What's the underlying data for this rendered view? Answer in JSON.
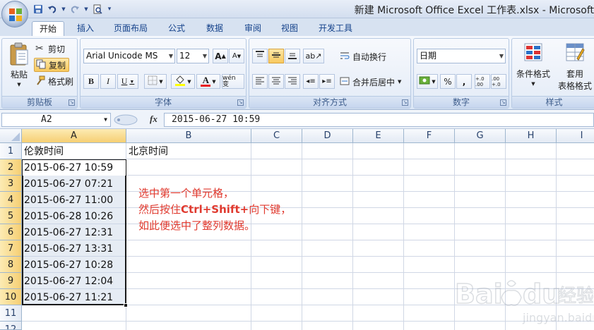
{
  "window": {
    "title": "新建 Microsoft Office Excel 工作表.xlsx - Microsoft"
  },
  "tabs": [
    "开始",
    "插入",
    "页面布局",
    "公式",
    "数据",
    "审阅",
    "视图",
    "开发工具"
  ],
  "ribbon": {
    "clipboard": {
      "label": "剪贴板",
      "paste": "粘贴",
      "cut": "剪切",
      "copy": "复制",
      "format_painter": "格式刷"
    },
    "font": {
      "label": "字体",
      "font_name": "Arial Unicode MS",
      "font_size": "12",
      "bold": "B",
      "italic": "I",
      "underline": "U",
      "grow": "A",
      "shrink": "A",
      "pinyin": "wén 变"
    },
    "alignment": {
      "label": "对齐方式",
      "wrap_text": "自动换行",
      "merge_center": "合并后居中"
    },
    "number": {
      "label": "数字",
      "format": "日期",
      "percent": "%",
      "comma": ",",
      "inc_decimal": "+.0 .00",
      "dec_decimal": ".00 +.0"
    },
    "styles": {
      "label": "样式",
      "conditional": "条件格式",
      "format_table": "套用",
      "format_table_2": "表格格式"
    }
  },
  "formula_bar": {
    "name_box": "A2",
    "fx": "fx",
    "value": "2015-06-27 10:59"
  },
  "sheet": {
    "columns": [
      "A",
      "B",
      "C",
      "D",
      "E",
      "F",
      "G",
      "H",
      "I"
    ],
    "rows": [
      "1",
      "2",
      "3",
      "4",
      "5",
      "6",
      "7",
      "8",
      "9",
      "10",
      "11",
      "12"
    ],
    "header_a1": "伦敦时间",
    "header_b1": "北京时间",
    "column_a_values": [
      "2015-06-27 10:59",
      "2015-06-27 07:21",
      "2015-06-27 11:00",
      "2015-06-28 10:26",
      "2015-06-27 12:31",
      "2015-06-27 13:31",
      "2015-06-27 10:28",
      "2015-06-27 12:04",
      "2015-06-27 11:21"
    ]
  },
  "annotation": {
    "line1": "选中第一个单元格，",
    "line2_pre": "然后按住",
    "line2_kbd": "Ctrl+Shift+",
    "line2_post": "向下键，",
    "line3": "如此便选中了整列数据。"
  },
  "colors": {
    "ribbon_bg": "#e6eef9",
    "selection_border": "#1a1a1a",
    "header_highlight": "#f6cf73",
    "annotation_red": "#e03a2f"
  }
}
